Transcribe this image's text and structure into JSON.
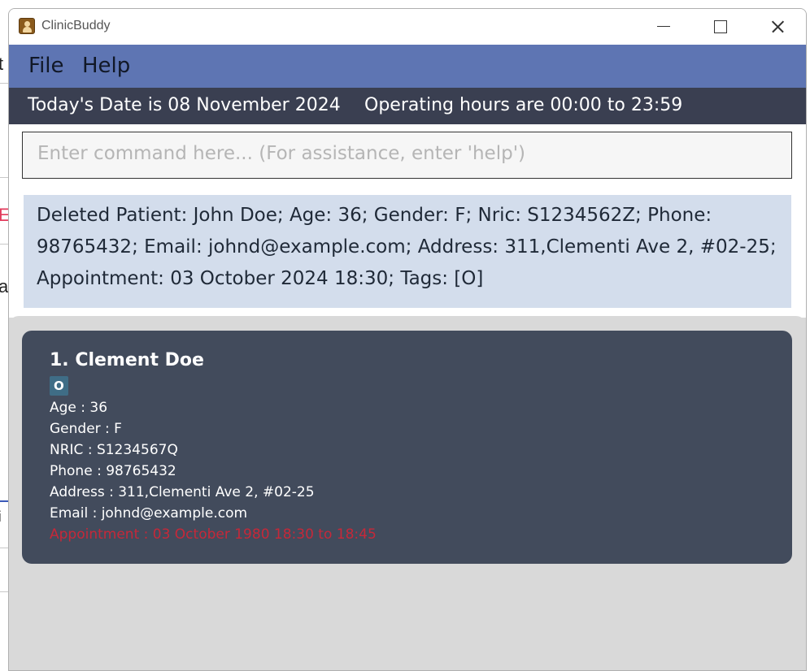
{
  "background": {
    "peek_texts": [
      "t",
      "E",
      "a",
      "i"
    ],
    "peek_colors": {
      "accent_red": "#e23b5c",
      "accent_blue": "#3b58b8"
    }
  },
  "window": {
    "title": "ClinicBuddy",
    "icon": "contact-book-icon",
    "controls": [
      "minimize-icon",
      "maximize-icon",
      "close-icon"
    ]
  },
  "menu": {
    "file_label": "File",
    "help_label": "Help"
  },
  "status": {
    "date_text": "Today's Date is 08 November 2024",
    "hours_text": "Operating hours are 00:00 to 23:59"
  },
  "command": {
    "value": "",
    "placeholder": "Enter command here... (For assistance, enter 'help')"
  },
  "result": {
    "message": "Deleted Patient: John Doe; Age: 36; Gender: F; Nric: S1234562Z; Phone: 98765432; Email: johnd@example.com; Address: 311,Clementi Ave 2, #02-25; Appointment: 03 October 2024 18:30; Tags: [O]"
  },
  "patients": [
    {
      "header": "1. Clement Doe",
      "tag": "O",
      "age": "Age : 36",
      "gender": "Gender : F",
      "nric": "NRIC : S1234567Q",
      "phone": "Phone : 98765432",
      "address": "Address : 311,Clementi Ave 2, #02-25",
      "email": "Email : johnd@example.com",
      "appointment": "Appointment : 03 October 1980 18:30 to 18:45"
    }
  ],
  "colors": {
    "menubar": "#5e75b3",
    "statusbar": "#3a3f51",
    "result_bg": "#d3ddec",
    "card_bg": "#424b5c",
    "tag_bg": "#3f6d86",
    "appointment_text": "#c62839"
  }
}
